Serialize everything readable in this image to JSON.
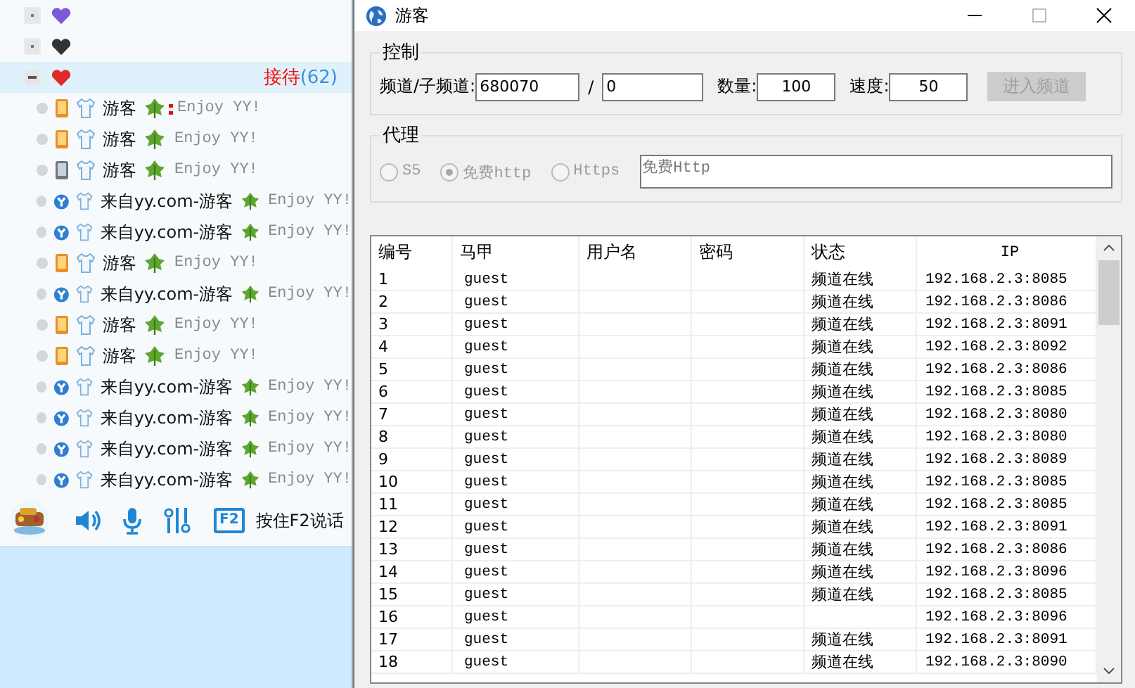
{
  "sidebar": {
    "groups": [
      {
        "color": "#7b5bd8",
        "expanded": false,
        "selected": false
      },
      {
        "color": "#333333",
        "expanded": false,
        "selected": false
      },
      {
        "color": "#e02a2a",
        "expanded": true,
        "selected": true,
        "label": "接待",
        "count": "(62)"
      }
    ],
    "users": [
      {
        "kind": "mobile",
        "name": "游客",
        "signature": "Enjoy YY!",
        "marked": true
      },
      {
        "kind": "mobile",
        "name": "游客",
        "signature": "Enjoy YY!",
        "marked": false
      },
      {
        "kind": "mobile-dim",
        "name": "游客",
        "signature": "Enjoy YY!",
        "marked": false
      },
      {
        "kind": "web",
        "name": "来自yy.com-游客",
        "signature": "Enjoy YY!",
        "marked": false
      },
      {
        "kind": "web",
        "name": "来自yy.com-游客",
        "signature": "Enjoy YY!",
        "marked": false
      },
      {
        "kind": "mobile",
        "name": "游客",
        "signature": "Enjoy YY!",
        "marked": false
      },
      {
        "kind": "web",
        "name": "来自yy.com-游客",
        "signature": "Enjoy YY!",
        "marked": false
      },
      {
        "kind": "mobile",
        "name": "游客",
        "signature": "Enjoy YY!",
        "marked": false
      },
      {
        "kind": "mobile",
        "name": "游客",
        "signature": "Enjoy YY!",
        "marked": false
      },
      {
        "kind": "web",
        "name": "来自yy.com-游客",
        "signature": "Enjoy YY!",
        "marked": false
      },
      {
        "kind": "web",
        "name": "来自yy.com-游客",
        "signature": "Enjoy YY!",
        "marked": false
      },
      {
        "kind": "web",
        "name": "来自yy.com-游客",
        "signature": "Enjoy YY!",
        "marked": false
      },
      {
        "kind": "web",
        "name": "来自yy.com-游客",
        "signature": "Enjoy YY!",
        "marked": false
      }
    ]
  },
  "toolbar": {
    "key": "F2",
    "hint": "按住F2说话"
  },
  "window": {
    "title": "游客"
  },
  "control": {
    "legend": "控制",
    "channel_label": "频道/子频道:",
    "channel": "680070",
    "separator": "/",
    "subchannel": "0",
    "count_label": "数量:",
    "count": "100",
    "speed_label": "速度:",
    "speed": "50",
    "enter_button": {
      "label": "进入频道",
      "disabled": true
    }
  },
  "proxy": {
    "legend": "代理",
    "options": [
      {
        "label": "S5",
        "selected": false,
        "disabled": true
      },
      {
        "label": "免费http",
        "selected": true,
        "disabled": true
      },
      {
        "label": "Https",
        "selected": false,
        "disabled": true
      }
    ],
    "value": "免费Http"
  },
  "table": {
    "columns": [
      "编号",
      "马甲",
      "用户名",
      "密码",
      "状态",
      "IP"
    ],
    "rows": [
      {
        "no": "1",
        "alias": "guest",
        "status": "频道在线",
        "ip": "192.168.2.3:8085"
      },
      {
        "no": "2",
        "alias": "guest",
        "status": "频道在线",
        "ip": "192.168.2.3:8086"
      },
      {
        "no": "3",
        "alias": "guest",
        "status": "频道在线",
        "ip": "192.168.2.3:8091"
      },
      {
        "no": "4",
        "alias": "guest",
        "status": "频道在线",
        "ip": "192.168.2.3:8092"
      },
      {
        "no": "5",
        "alias": "guest",
        "status": "频道在线",
        "ip": "192.168.2.3:8086"
      },
      {
        "no": "6",
        "alias": "guest",
        "status": "频道在线",
        "ip": "192.168.2.3:8085"
      },
      {
        "no": "7",
        "alias": "guest",
        "status": "频道在线",
        "ip": "192.168.2.3:8080"
      },
      {
        "no": "8",
        "alias": "guest",
        "status": "频道在线",
        "ip": "192.168.2.3:8080"
      },
      {
        "no": "9",
        "alias": "guest",
        "status": "频道在线",
        "ip": "192.168.2.3:8089"
      },
      {
        "no": "10",
        "alias": "guest",
        "status": "频道在线",
        "ip": "192.168.2.3:8085"
      },
      {
        "no": "11",
        "alias": "guest",
        "status": "频道在线",
        "ip": "192.168.2.3:8085"
      },
      {
        "no": "12",
        "alias": "guest",
        "status": "频道在线",
        "ip": "192.168.2.3:8091"
      },
      {
        "no": "13",
        "alias": "guest",
        "status": "频道在线",
        "ip": "192.168.2.3:8086"
      },
      {
        "no": "14",
        "alias": "guest",
        "status": "频道在线",
        "ip": "192.168.2.3:8096"
      },
      {
        "no": "15",
        "alias": "guest",
        "status": "频道在线",
        "ip": "192.168.2.3:8085"
      },
      {
        "no": "16",
        "alias": "guest",
        "ip": "192.168.2.3:8096"
      },
      {
        "no": "17",
        "alias": "guest",
        "status": "频道在线",
        "ip": "192.168.2.3:8091"
      },
      {
        "no": "18",
        "alias": "guest",
        "status": "频道在线",
        "ip": "192.168.2.3:8090"
      }
    ]
  }
}
